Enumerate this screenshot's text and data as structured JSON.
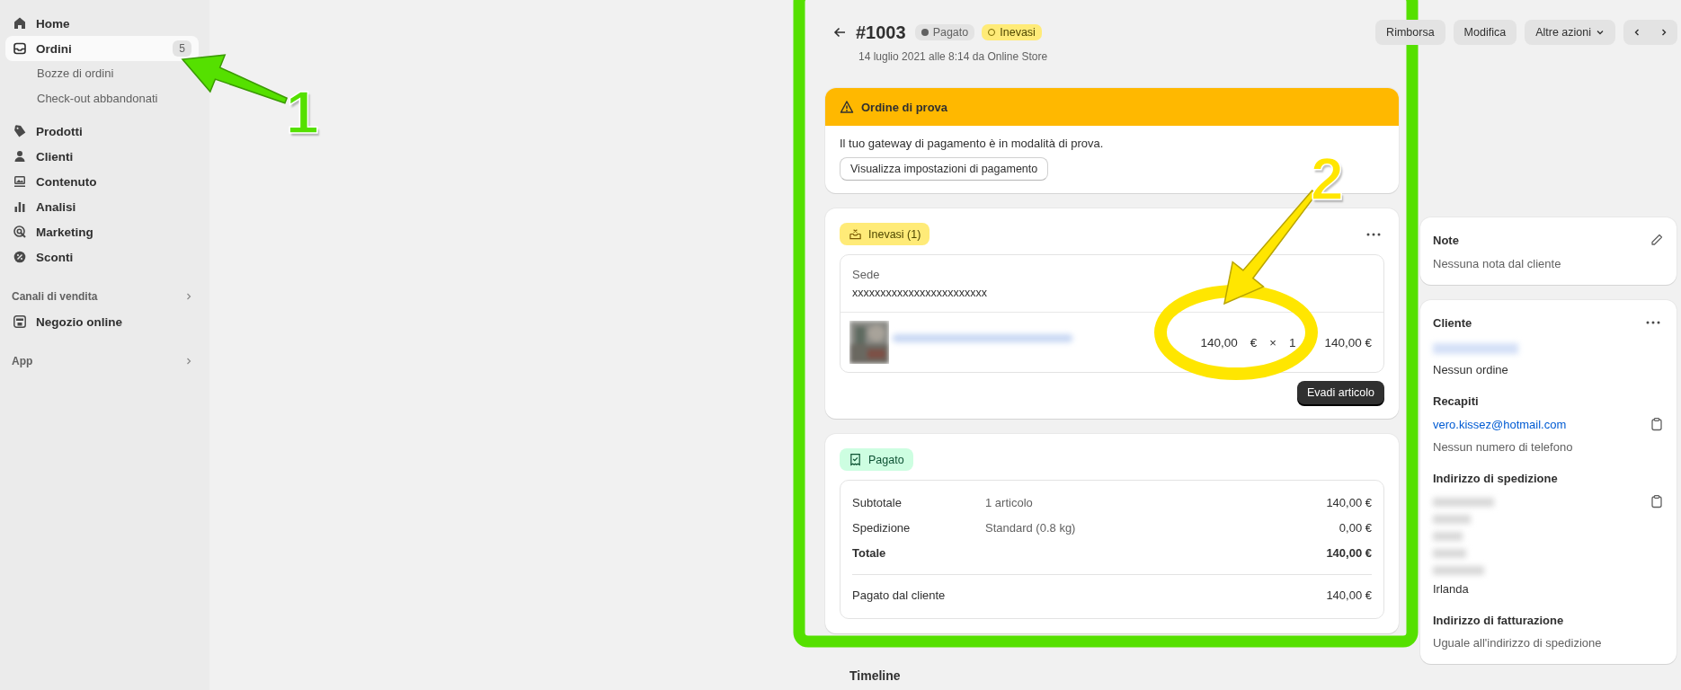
{
  "sidebar": {
    "items": [
      {
        "label": "Home",
        "kind": "home",
        "selected": false
      },
      {
        "label": "Ordini",
        "kind": "inbox",
        "selected": true,
        "badge": "5",
        "children": [
          {
            "label": "Bozze di ordini",
            "selected": false
          },
          {
            "label": "Check-out abbandonati",
            "selected": false
          }
        ]
      },
      {
        "label": "Prodotti",
        "kind": "tag",
        "selected": false
      },
      {
        "label": "Clienti",
        "kind": "person",
        "selected": false
      },
      {
        "label": "Contenuto",
        "kind": "content",
        "selected": false
      },
      {
        "label": "Analisi",
        "kind": "bars",
        "selected": false
      },
      {
        "label": "Marketing",
        "kind": "target",
        "selected": false
      },
      {
        "label": "Sconti",
        "kind": "discount",
        "selected": false
      }
    ],
    "sections": [
      {
        "title": "Canali di vendita",
        "items": [
          {
            "label": "Negozio online",
            "kind": "store",
            "selected": false
          }
        ]
      },
      {
        "title": "App"
      }
    ]
  },
  "header": {
    "title": "#1003",
    "badges": [
      {
        "label": "Pagato",
        "kind": "paid"
      },
      {
        "label": "Inevasi",
        "kind": "unfulfilled"
      }
    ],
    "subtitle": "14 luglio 2021 alle 8:14 da Online Store",
    "actions": [
      {
        "label": "Rimborsa",
        "dropdown": false
      },
      {
        "label": "Modifica",
        "dropdown": false
      },
      {
        "label": "Altre azioni",
        "dropdown": true
      }
    ]
  },
  "banner": {
    "title": "Ordine di prova",
    "message": "Il tuo gateway di pagamento è in modalità di prova.",
    "button": "Visualizza impostazioni di pagamento"
  },
  "unfulfilled": {
    "status": "Inevasi (1)",
    "location_label": "Sede",
    "location": "xxxxxxxxxxxxxxxxxxxxxxxx",
    "line_items": [
      {
        "unit_price": "140,00",
        "currency": "€",
        "times": "×",
        "quantity": "1",
        "total": "140,00 €"
      }
    ],
    "button": "Evadi articolo"
  },
  "payment": {
    "status": "Pagato",
    "rows": [
      {
        "label": "Subtotale",
        "detail": "1 articolo",
        "amount": "140,00 €",
        "bold": false
      },
      {
        "label": "Spedizione",
        "detail": "Standard (0.8 kg)",
        "amount": "0,00 €",
        "bold": false
      },
      {
        "label": "Totale",
        "amount": "140,00 €",
        "bold": true
      }
    ],
    "paid_label": "Pagato dal cliente",
    "paid_amount": "140,00 €"
  },
  "timeline": {
    "title": "Timeline"
  },
  "note": {
    "title": "Note",
    "text": "Nessuna nota dal cliente"
  },
  "customer": {
    "title": "Cliente",
    "orders": "Nessun ordine",
    "contact_title": "Recapiti",
    "email": "vero.kissez@hotmail.com",
    "phone": "Nessun numero di telefono",
    "shipping_title": "Indirizzo di spedizione",
    "country": "Irlanda",
    "billing_title": "Indirizzo di fatturazione",
    "billing": "Uguale all'indirizzo di spedizione"
  },
  "annotations": [
    {
      "label": "1",
      "color": "#55e000"
    },
    {
      "label": "2",
      "color": "#ffe600"
    }
  ]
}
